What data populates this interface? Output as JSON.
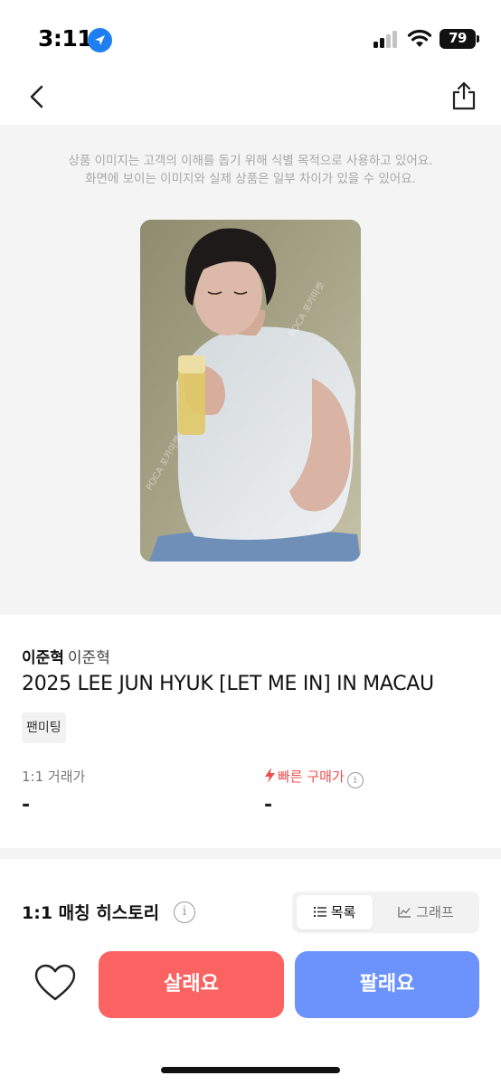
{
  "status_bar": {
    "time": "3:11",
    "battery_level": "79",
    "icons": [
      "location-arrow-icon",
      "cellular-signal-icon",
      "wifi-icon",
      "battery-icon"
    ]
  },
  "nav": {
    "icons": [
      "back-arrow-icon",
      "share-icon"
    ]
  },
  "image_section": {
    "notice_line1": "상품 이미지는 고객의 이해를 돕기 위해 식별 목적으로 사용하고 있어요.",
    "notice_line2": "화면에 보이는 이미지와 실제 상품은 일부 차이가 있을 수 있어요.",
    "watermark": "POCA 포카마켓"
  },
  "product": {
    "artist_bold": "이준혁",
    "artist_sub": "이준혁",
    "title": "2025 LEE JUN HYUK [LET ME IN] IN MACAU",
    "tag": "팬미팅"
  },
  "prices": {
    "trade_label": "1:1 거래가",
    "trade_value": "-",
    "fast_label": "빠른 구매가",
    "fast_value": "-"
  },
  "history": {
    "title": "1:1 매칭 히스토리",
    "toggle_list": "목록",
    "toggle_graph": "그래프",
    "selected": "목록"
  },
  "actions": {
    "buy_label": "살래요",
    "sell_label": "팔래요"
  },
  "colors": {
    "buy_button": "#fb6262",
    "sell_button": "#6b93fb",
    "fast_price": "#ef4d4d",
    "location_icon": "#1f7ff0"
  }
}
